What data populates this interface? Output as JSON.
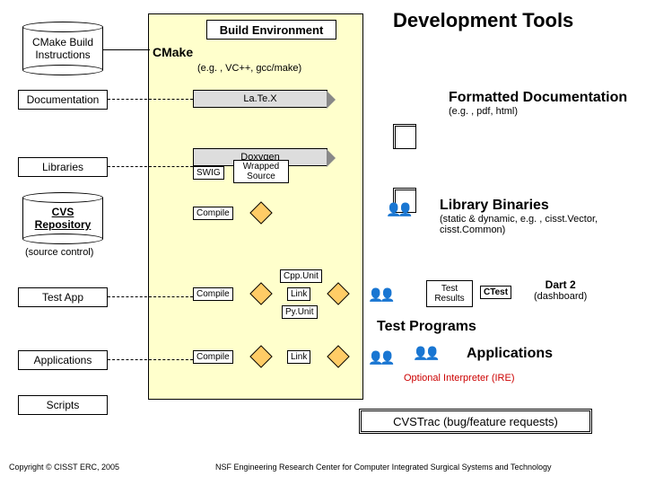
{
  "title": "Development Tools",
  "build_env": "Build Environment",
  "cmake": "CMake",
  "toolchain": "(e.g. , VC++, gcc/make)",
  "left": {
    "cmake_instr": "CMake Build Instructions",
    "documentation": "Documentation",
    "libraries": "Libraries",
    "cvs_repo": "CVS Repository",
    "cvs_sub": "(source control)",
    "test_app": "Test App",
    "applications": "Applications",
    "scripts": "Scripts"
  },
  "mid": {
    "latex": "La.Te.X",
    "doxygen": "Doxygen",
    "swig": "SWIG",
    "wrapped": "Wrapped Source",
    "compile": "Compile",
    "cppunit": "Cpp.Unit",
    "link": "Link",
    "pyunit": "Py.Unit"
  },
  "right": {
    "formatted": "Formatted Documentation",
    "formatted_sub": "(e.g. , pdf, html)",
    "lib_bin": "Library Binaries",
    "lib_bin_sub": "(static & dynamic, e.g. , cisst.Vector, cisst.Common)",
    "test_results": "Test Results",
    "ctest": "CTest",
    "dart2": "Dart 2",
    "dashboard": "(dashboard)",
    "test_programs": "Test Programs",
    "applications": "Applications",
    "ire": "Optional Interpreter (IRE)"
  },
  "bottom": {
    "cvstrac": "CVSTrac (bug/feature requests)"
  },
  "footer": {
    "copyright": "Copyright © CISST ERC, 2005",
    "nsf": "NSF Engineering Research Center for Computer Integrated Surgical Systems and Technology"
  }
}
